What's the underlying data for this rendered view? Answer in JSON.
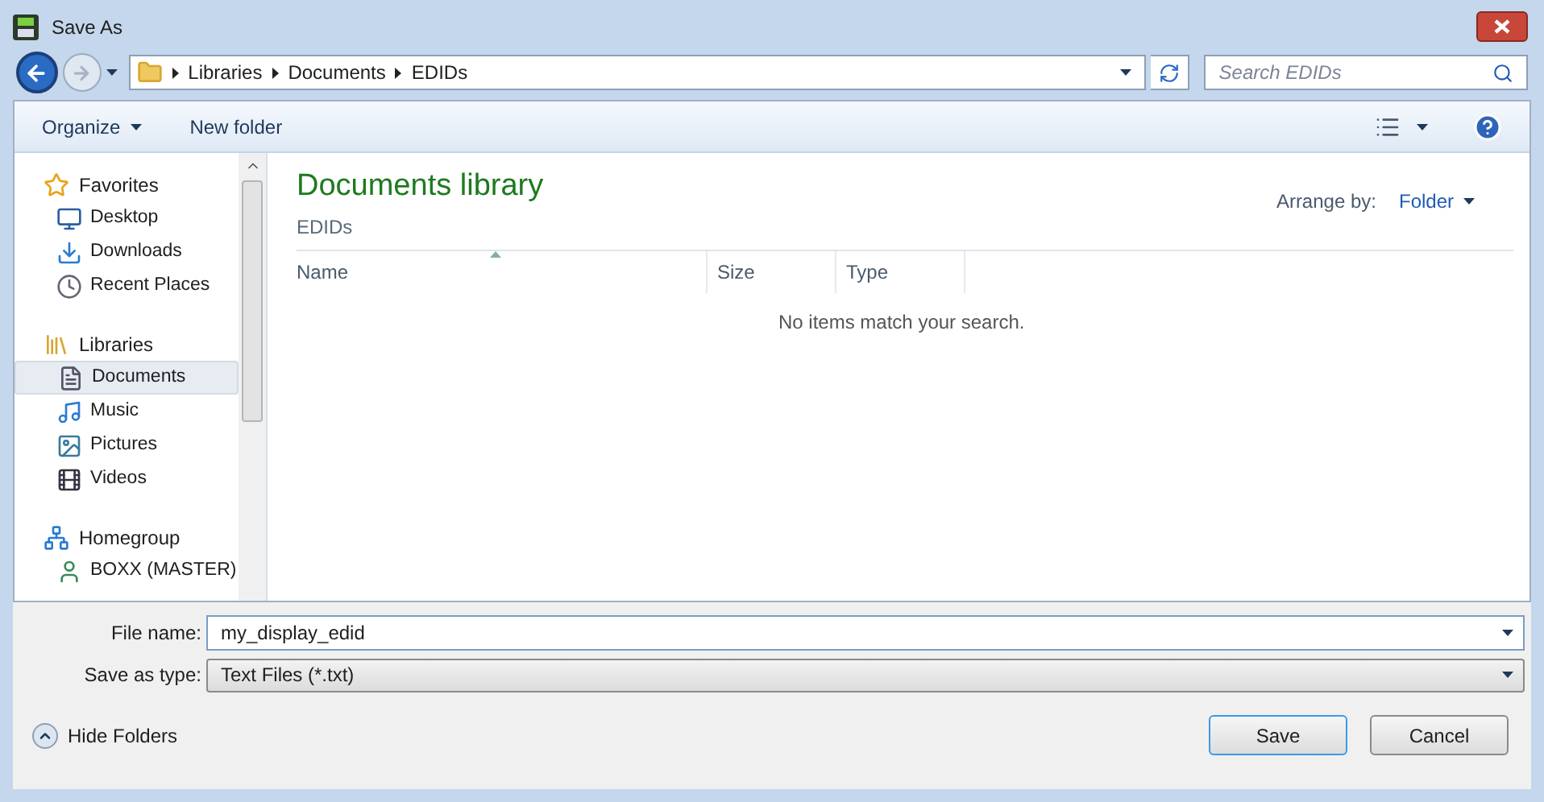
{
  "window": {
    "title": "Save As"
  },
  "address": {
    "crumbs": [
      "Libraries",
      "Documents",
      "EDIDs"
    ]
  },
  "search": {
    "placeholder": "Search EDIDs"
  },
  "toolbar": {
    "organize": "Organize",
    "new_folder": "New folder"
  },
  "sidebar": {
    "groups": [
      {
        "label": "Favorites",
        "children": [
          {
            "label": "Desktop",
            "selected": false
          },
          {
            "label": "Downloads",
            "selected": false
          },
          {
            "label": "Recent Places",
            "selected": false
          }
        ]
      },
      {
        "label": "Libraries",
        "children": [
          {
            "label": "Documents",
            "selected": true
          },
          {
            "label": "Music",
            "selected": false
          },
          {
            "label": "Pictures",
            "selected": false
          },
          {
            "label": "Videos",
            "selected": false
          }
        ]
      },
      {
        "label": "Homegroup",
        "children": [
          {
            "label": "BOXX (MASTER)",
            "selected": false
          }
        ]
      }
    ]
  },
  "content": {
    "title": "Documents library",
    "subtitle": "EDIDs",
    "arrange_label": "Arrange by:",
    "arrange_value": "Folder",
    "columns": [
      "Name",
      "Size",
      "Type"
    ],
    "empty_message": "No items match your search."
  },
  "file_name": {
    "label": "File name:",
    "value": "my_display_edid"
  },
  "save_type": {
    "label": "Save as type:",
    "value": "Text Files (*.txt)"
  },
  "hide_folders": "Hide Folders",
  "buttons": [
    "Save",
    "Cancel"
  ]
}
